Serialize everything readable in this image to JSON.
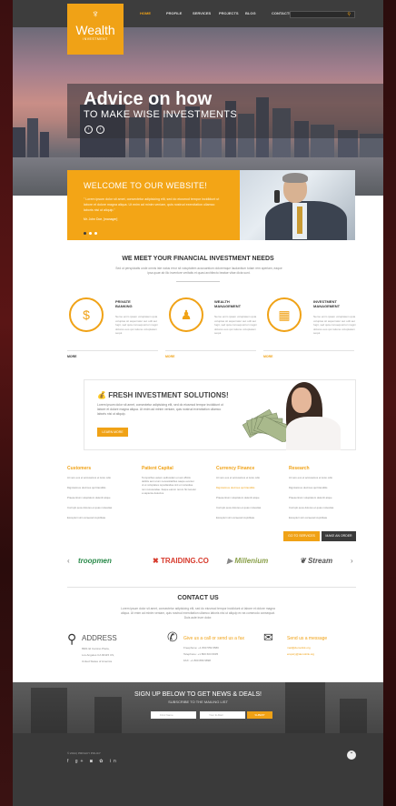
{
  "header": {
    "logo_name": "Wealth",
    "logo_sub": "INVESTMENT",
    "nav": [
      "HOME",
      "PROFILE",
      "SERVICES",
      "PROJECTS",
      "BLOG",
      "CONTACTS"
    ],
    "search_placeholder": ""
  },
  "hero": {
    "title": "Advice on how",
    "subtitle": "TO MAKE WISE INVESTMENTS",
    "prev": "‹",
    "next": "›"
  },
  "welcome": {
    "title": "WELCOME TO OUR WEBSITE!",
    "quote": "\" Lorem ipsum dolor sit amet, consectetur adipisicing elit, sed do eiusmod tempor incididunt ut labore et dolore magna aliqua. Ut enim ad minim veniam, quis nostrud exercitation ullamco laboris nisi ut aliquip.\"",
    "author": "Mr. John Doe, [manager]"
  },
  "needs": {
    "title": "WE MEET YOUR FINANCIAL INVESTMENT NEEDS",
    "text": "Sed ut perspiciatis unde omnis iste natus error sit voluptatem accusantium doloremque laudantium totam rem aperiam, eaque ipsa quae ab illo inventore veritatis et quasi architecto beatae vitae dicta sunt.",
    "features": [
      {
        "title": "PRIVATE\nBANKING",
        "text": "Nemo enim ipsam voluptatem quia voluptas sit aspernatur aut odit aut fugit, sed quia consequuntur magni dolores eos qui ratione voluptatem sequi.",
        "more": "MORE",
        "icon": "$"
      },
      {
        "title": "WEALTH\nMANAGEMENT",
        "text": "Nemo enim ipsam voluptatem quia voluptas sit aspernatur aut odit aut fugit, sed quia consequuntur magni dolores eos qui ratione voluptatem sequi.",
        "more": "MORE",
        "icon": "♟"
      },
      {
        "title": "INVESTMENT\nMANAGEMENT",
        "text": "Nemo enim ipsam voluptatem quia voluptas sit aspernatur aut odit aut fugit, sed quia consequuntur magni dolores eos qui ratione voluptatem sequi.",
        "more": "MORE",
        "icon": "▦"
      }
    ]
  },
  "fresh": {
    "title": "FRESH INVESTMENT SOLUTIONS!",
    "text": "Lorem ipsum dolor sit amet, consectetur adipisicing elit, sed do eiusmod tempor incididunt ut labore et dolore magna aliqua. Ut enim ad minim veniam, quis nostrud exercitation ullamco laboris nisi ut aliquip.",
    "button": "LEARN MORE"
  },
  "columns": [
    {
      "title": "Customers",
      "items": [
        "At vero eos et accusamus et iusto odio",
        "Dignissimos ducimus qui blanditiis",
        "Praesentium voluptatum deleniti atque",
        "Corrupti quos dolores et quas molestias",
        "Excepturi sint occaecati cupiditate"
      ]
    },
    {
      "title": "Patient Capital",
      "text": "Temporibus autem quibusdam et aut officiis debitis aut rerum necessitatibus saepe eveniet ut et voluptates repudiandae sint et molestiae non recusandae. Itaque earum rerum hic tenetur a sapiente delectus."
    },
    {
      "title": "Currency Finance",
      "items": [
        "At vero eos et accusamus et iusto odio",
        "Dignissimos ducimus qui blanditiis",
        "Praesentium voluptatum deleniti atque",
        "Corrupti quos dolores et quas molestias",
        "Excepturi sint occaecati cupiditate"
      ]
    },
    {
      "title": "Research",
      "items": [
        "At vero eos et accusamus et iusto odio",
        "Dignissimos ducimus qui blanditiis",
        "Praesentium voluptatum deleniti atque",
        "Corrupti quos dolores et quas molestias",
        "Excepturi sint occaecati cupiditate"
      ]
    }
  ],
  "actions": {
    "primary": "GO TO SERVICES",
    "secondary": "MAKE AN ORDER"
  },
  "partners": [
    "troopmen",
    "TRAIDING.CO",
    "Millenium",
    "Stream"
  ],
  "contact": {
    "title": "CONTACT US",
    "text": "Lorem ipsum dolor sit amet, consectetur adipisicing elit, sed do eiusmod tempor incididunt ut labore et dolore magna aliqua. Ut enim ad minim veniam, quis nostrud exercitation ullamco laboris nisi ut aliquip ex ea commodo consequat. Duis aute irure dolor.",
    "address_title": "ADDRESS",
    "address_lines": [
      "8901 El Camino Plaza,",
      "Los Angeles CA 90115 US,",
      "United States of America"
    ],
    "phone_title": "Give us a call or send us a fax",
    "phone_lines": [
      "Freephone:  +1 800 559 6580",
      "Telephone:  +1 800 603 6035",
      "FAX:         +1 800 889 9898"
    ],
    "mail_title": "Send us a message",
    "mail_lines": [
      "mail@demolink.org",
      "enquiry@demolink.org"
    ]
  },
  "newsletter": {
    "title": "SIGN UP BELOW TO GET NEWS & DEALS!",
    "subtitle": "SUBSCRIBE TO THE MAILING LIST",
    "name_placeholder": "First Name",
    "email_placeholder": "Your E-Mail",
    "button": "SUBMIT"
  },
  "footer": {
    "copy": "© 2014 | PRIVACY POLICY",
    "social": "f  g+  ◙  ✿  in",
    "top": "⌃"
  },
  "colors": {
    "accent": "#f0a216",
    "dark": "#3a3a3a"
  }
}
